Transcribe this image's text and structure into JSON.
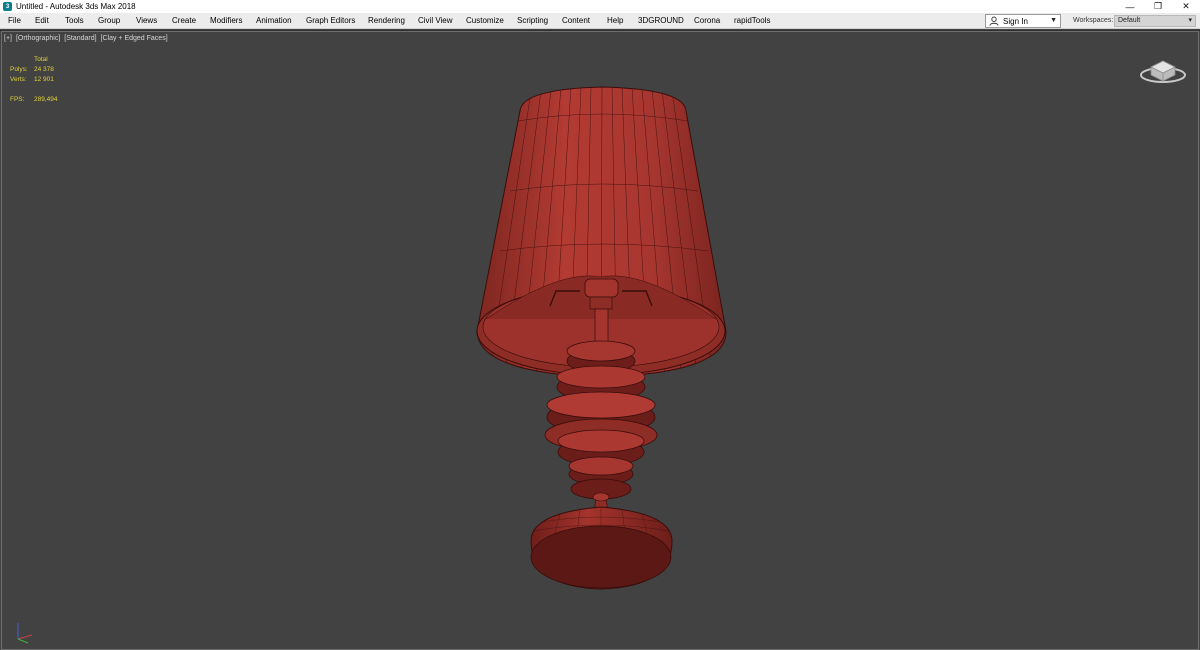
{
  "window": {
    "title": "Untitled - Autodesk 3ds Max 2018",
    "app_icon": "3ds-max-icon",
    "controls": [
      "—",
      "❐",
      "✕"
    ]
  },
  "menubar": {
    "items": [
      "File",
      "Edit",
      "Tools",
      "Group",
      "Views",
      "Create",
      "Modifiers",
      "Animation",
      "Graph Editors",
      "Rendering",
      "Civil View",
      "Customize",
      "Scripting",
      "Content",
      "Help",
      "3DGROUND",
      "Corona",
      "rapidTools"
    ],
    "signin_label": "Sign In",
    "workspaces_label": "Workspaces:",
    "workspaces_value": "Default"
  },
  "viewport": {
    "label_parts": [
      "[+]",
      "[Orthographic]",
      "[Standard]",
      "[Clay + Edged Faces]"
    ],
    "stats": {
      "header": "Total",
      "polys_label": "Polys:",
      "polys_value": "24 378",
      "verts_label": "Verts:",
      "verts_value": "12 901",
      "fps_label": "FPS:",
      "fps_value": "289,494"
    },
    "object": "table-lamp",
    "colors": {
      "background": "#424242",
      "clay": "#a8362f",
      "wire": "#3a0d0b",
      "stats": "#e0d23a"
    }
  }
}
